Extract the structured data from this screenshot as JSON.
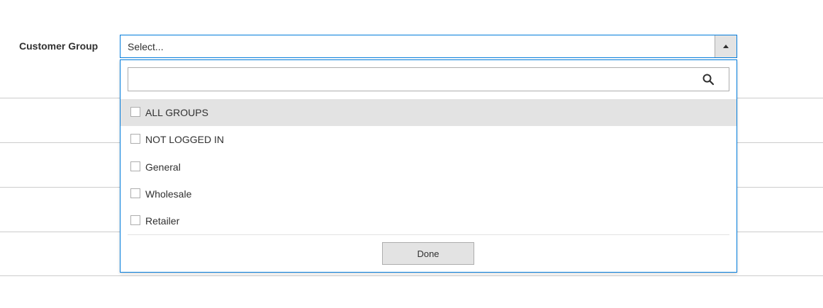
{
  "field": {
    "label": "Customer Group",
    "select_placeholder": "Select..."
  },
  "dropdown": {
    "search_value": "",
    "options": [
      {
        "label": "ALL GROUPS",
        "checked": false
      },
      {
        "label": "NOT LOGGED IN",
        "checked": false
      },
      {
        "label": "General",
        "checked": false
      },
      {
        "label": "Wholesale",
        "checked": false
      },
      {
        "label": "Retailer",
        "checked": false
      }
    ],
    "done_label": "Done"
  },
  "icons": {
    "toggle": "arrow-up-icon",
    "search": "search-icon"
  },
  "colors": {
    "accent": "#007bdb",
    "highlight": "#e3e3e3",
    "text": "#303030"
  }
}
